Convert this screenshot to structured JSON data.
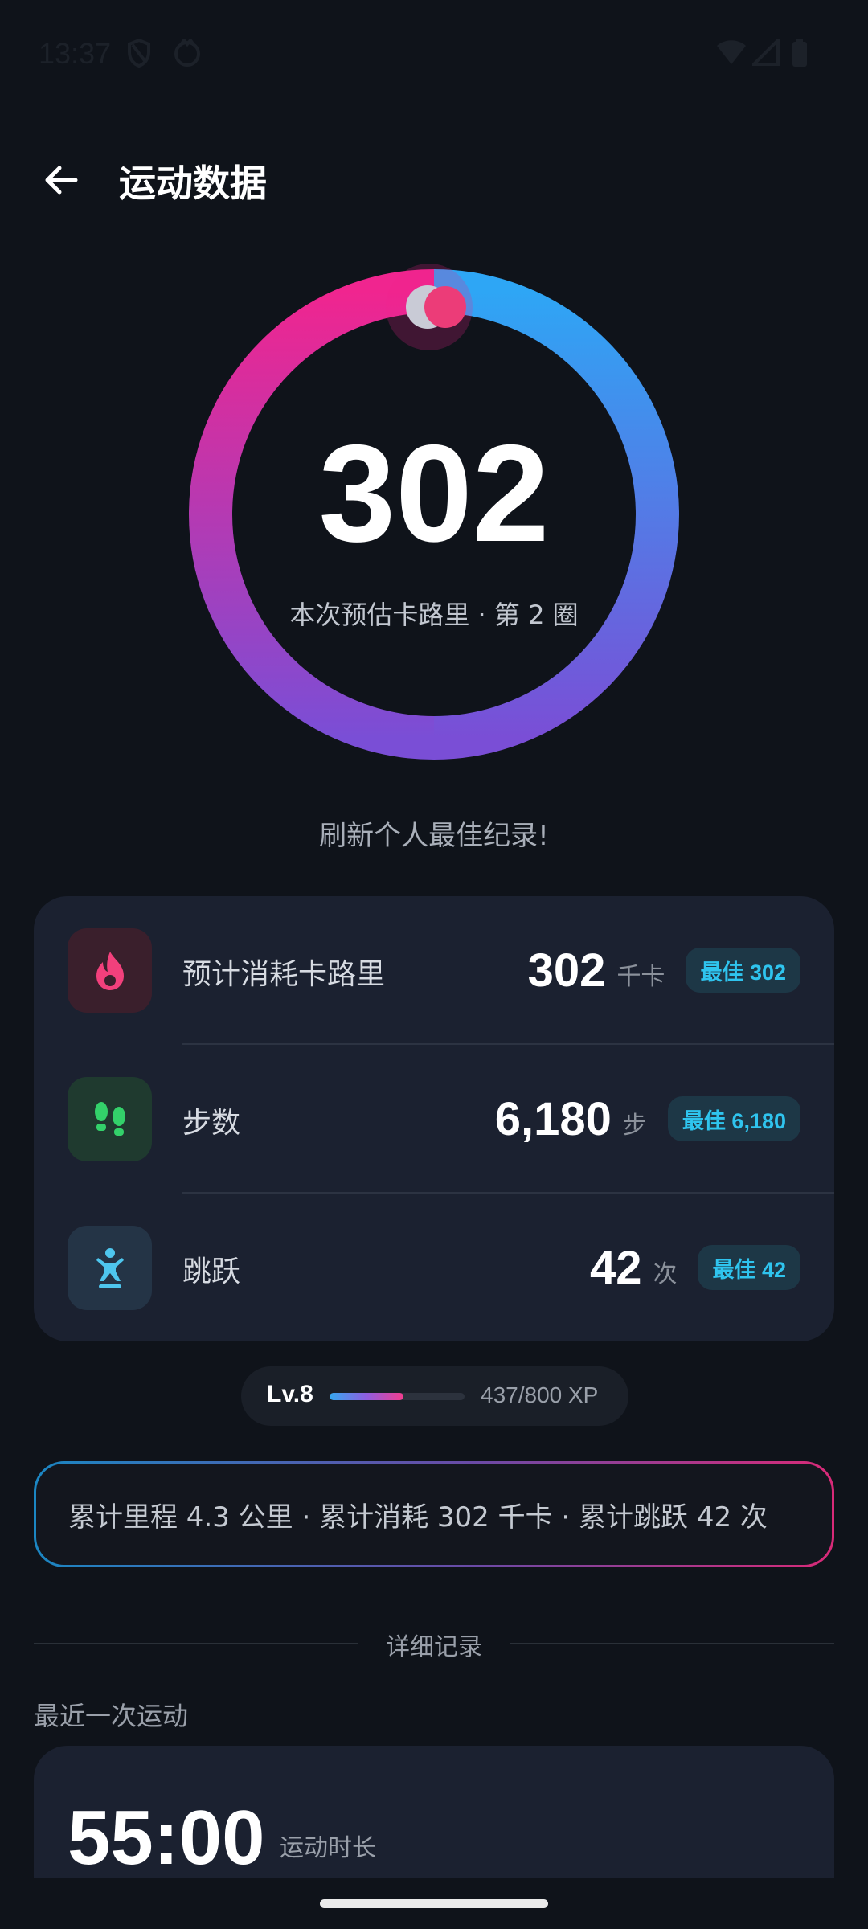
{
  "status_bar": {
    "time": "13:37",
    "icons": [
      "shield-icon",
      "face-icon",
      "wifi-icon",
      "signal-icon",
      "battery-icon"
    ]
  },
  "header": {
    "title": "运动数据",
    "back_icon": "arrow-left-icon"
  },
  "ring": {
    "value": "302",
    "subtitle": "本次预估卡路里 · 第 2 圈",
    "gradient_colors": [
      "#2ea6f5",
      "#7a4ed6",
      "#f0258f"
    ]
  },
  "record_message": "刷新个人最佳纪录!",
  "stats": [
    {
      "icon": "flame-icon",
      "icon_bg": "#3a1f2c",
      "icon_color": "#f2407c",
      "label": "预计消耗卡路里",
      "value": "302",
      "unit": "千卡",
      "best": "最佳 302"
    },
    {
      "icon": "footprints-icon",
      "icon_bg": "#1f3a2f",
      "icon_color": "#33d16a",
      "label": "步数",
      "value": "6,180",
      "unit": "步",
      "best": "最佳 6,180"
    },
    {
      "icon": "jump-icon",
      "icon_bg": "#243446",
      "icon_color": "#4ec6ee",
      "label": "跳跃",
      "value": "42",
      "unit": "次",
      "best": "最佳 42"
    }
  ],
  "level": {
    "label": "Lv.8",
    "xp_text": "437/800 XP",
    "progress_fraction": 0.546
  },
  "summary": "累计里程 4.3 公里 · 累计消耗 302 千卡 · 累计跳跃 42 次",
  "section_title": "详细记录",
  "recent": {
    "heading": "最近一次运动",
    "duration": "55:00",
    "duration_label": "运动时长"
  },
  "colors": {
    "background": "#0f131a",
    "card": "#1b2130",
    "badge_text": "#2fc4ee"
  }
}
